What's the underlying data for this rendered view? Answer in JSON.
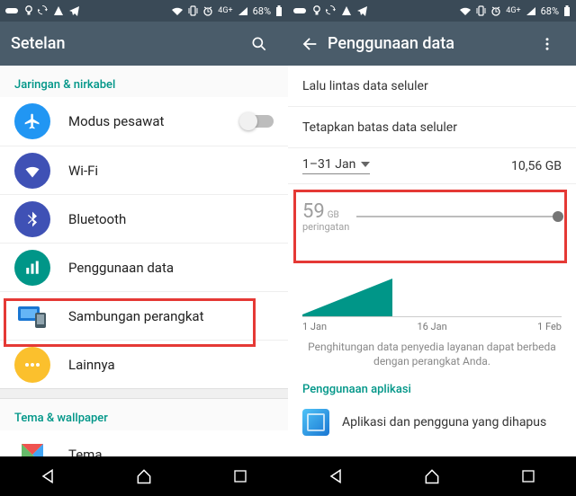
{
  "status": {
    "network": "4G+",
    "battery": "68%"
  },
  "left": {
    "title": "Setelan",
    "section_network": "Jaringan & nirkabel",
    "items": {
      "airplane": "Modus pesawat",
      "wifi": "Wi-Fi",
      "bluetooth": "Bluetooth",
      "data": "Penggunaan data",
      "device_conn": "Sambungan perangkat",
      "more": "Lainnya"
    },
    "section_theme": "Tema & wallpaper",
    "theme": "Tema"
  },
  "right": {
    "title": "Penggunaan data",
    "cellular_toggle": "Lalu lintas data seluler",
    "limit_toggle": "Tetapkan batas data seluler",
    "period": "1–31 Jan",
    "usage": "10,56 GB",
    "warning_value": "59",
    "warning_unit": "GB",
    "warning_label": "peringatan",
    "xaxis": {
      "a": "1 Jan",
      "b": "16 Jan",
      "c": "1 Feb"
    },
    "note": "Penghitungan data penyedia layanan dapat berbeda dengan perangkat Anda.",
    "section_apps": "Penggunaan aplikasi",
    "app_deleted": "Aplikasi dan pengguna yang dihapus"
  },
  "chart_data": {
    "type": "area",
    "title": "",
    "xlabel": "",
    "ylabel": "",
    "x_range": [
      "1 Jan",
      "1 Feb"
    ],
    "x_ticks": [
      "1 Jan",
      "16 Jan",
      "1 Feb"
    ],
    "warning_line_gb": 59,
    "series": [
      {
        "name": "cumulative_usage_gb",
        "x": [
          1,
          2,
          3,
          4,
          5,
          6,
          7,
          8,
          9,
          10,
          11
        ],
        "y": [
          0.5,
          1.2,
          2.1,
          3.0,
          4.2,
          5.3,
          6.5,
          7.6,
          8.8,
          9.7,
          10.56
        ]
      }
    ]
  }
}
